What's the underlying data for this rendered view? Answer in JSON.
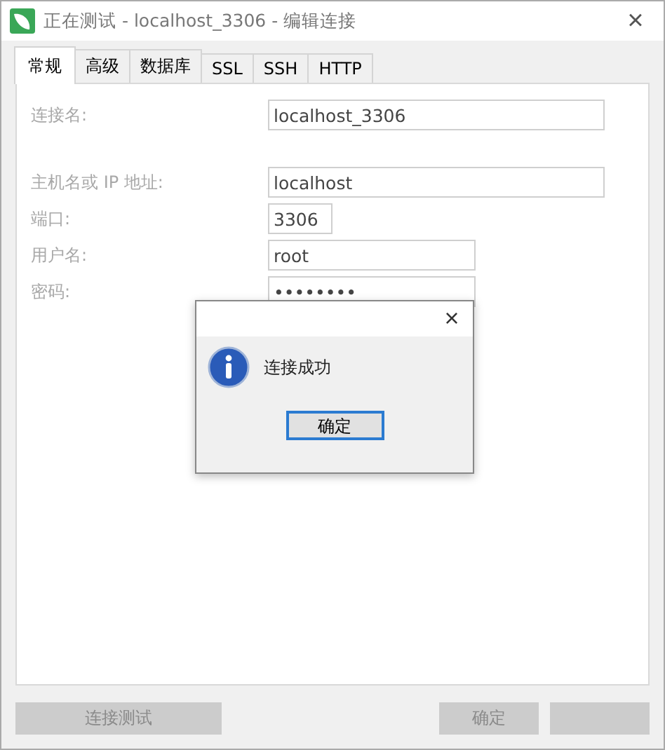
{
  "window": {
    "title": "正在测试 - localhost_3306 - 编辑连接",
    "close": "×"
  },
  "tabs": [
    {
      "label": "常规",
      "selected": true
    },
    {
      "label": "高级",
      "selected": false
    },
    {
      "label": "数据库",
      "selected": false
    },
    {
      "label": "SSL",
      "selected": false
    },
    {
      "label": "SSH",
      "selected": false
    },
    {
      "label": "HTTP",
      "selected": false
    }
  ],
  "form": {
    "disabled": true,
    "fields": [
      {
        "label": "连接名:",
        "value": "localhost_3306"
      },
      {
        "label": "主机名或 IP 地址:",
        "value": "localhost"
      },
      {
        "label": "端口:",
        "value": "3306"
      },
      {
        "label": "用户名:",
        "value": "root"
      },
      {
        "label": "密码:",
        "value": "••••••••"
      }
    ]
  },
  "dialog": {
    "close": "×",
    "message": "连接成功",
    "button": "确定"
  },
  "buttons": [
    {
      "label": "连接测试",
      "disabled": true
    },
    {
      "label": "确定",
      "disabled": true
    },
    {
      "disabled": true
    }
  ]
}
